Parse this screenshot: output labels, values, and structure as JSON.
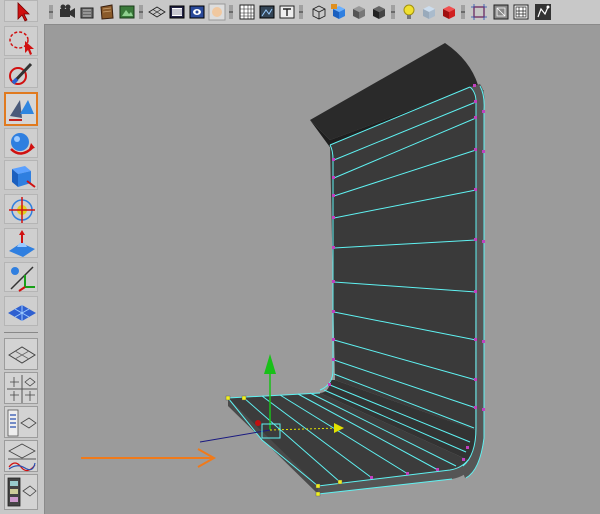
{
  "toolbox": {
    "tools": [
      {
        "name": "select-tool-icon",
        "active": false
      },
      {
        "name": "lasso-tool-icon",
        "active": false
      },
      {
        "name": "paint-select-tool-icon",
        "active": false
      },
      {
        "name": "move-tool-icon",
        "active": true
      },
      {
        "name": "rotate-tool-icon",
        "active": false
      },
      {
        "name": "scale-tool-icon",
        "active": false
      },
      {
        "name": "universal-manipulator-icon",
        "active": false
      },
      {
        "name": "soft-modification-icon",
        "active": false
      },
      {
        "name": "show-manipulator-icon",
        "active": false
      },
      {
        "name": "last-tool-used-icon",
        "active": false
      }
    ],
    "layouts": [
      "single-perspective-layout-icon",
      "four-view-layout-icon",
      "outliner-perspective-layout-icon",
      "graph-perspective-layout-icon",
      "hypershade-perspective-layout-icon"
    ]
  },
  "shelf": {
    "icons": [
      "camera-icon",
      "camera-aim-icon",
      "texture-icon",
      "ipr-render-icon",
      "grid-toggle-icon",
      "film-gate-icon",
      "resolution-gate-icon",
      "shaded-sphere-icon",
      "field-chart-icon",
      "safe-action-icon",
      "safe-title-icon",
      "wireframe-cube-icon",
      "smooth-shade-icon",
      "flat-shade-icon",
      "bounding-box-icon",
      "light-bulb-icon",
      "xray-icon",
      "isolate-select-icon",
      "frame-selection-icon",
      "wireframe-on-shaded-icon",
      "backface-icon",
      "snapshot-icon"
    ]
  },
  "viewport": {
    "name": "persp",
    "colors": {
      "background": "#9b9b9b",
      "mesh_face": "#3a3a3a",
      "mesh_side": "#555555",
      "wire": "#5ff2f2",
      "vertex": "#c040c0",
      "selected_vertex": "#f0f020",
      "arrow": "#f07a1a",
      "manip_y": "#18c018",
      "manip_x": "#1a1a80",
      "manip_z": "#e0e000"
    }
  }
}
